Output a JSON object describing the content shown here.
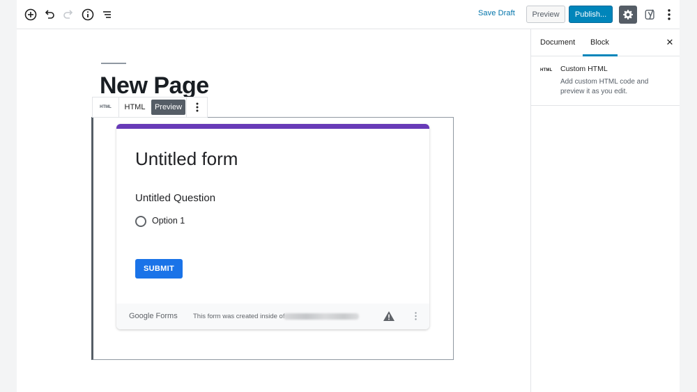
{
  "toolbar": {
    "icons": [
      "add-block-icon",
      "undo-icon",
      "redo-icon",
      "info-icon",
      "outline-icon"
    ],
    "save_draft": "Save Draft",
    "preview": "Preview",
    "publish": "Publish...",
    "settings_icon": "gear-icon",
    "plugin_icon": "yoast-icon",
    "more_icon": "more-vertical-icon"
  },
  "editor": {
    "page_title": "New Page",
    "block_toolbar": {
      "block_icon": "HTML",
      "html_tab": "HTML",
      "preview_tab": "Preview"
    }
  },
  "form": {
    "title": "Untitled form",
    "question": "Untitled Question",
    "option": "Option 1",
    "submit": "SUBMIT",
    "footer_brand": "Google Forms",
    "footer_note": "This form was created inside of",
    "accent_color": "#673ab7",
    "button_color": "#1a73e8"
  },
  "sidebar": {
    "tabs": [
      "Document",
      "Block"
    ],
    "active_tab": "Block",
    "block_icon": "HTML",
    "block_name": "Custom HTML",
    "block_description": "Add custom HTML code and preview it as you edit."
  },
  "colors": {
    "primary": "#0085ba",
    "link": "#0073aa",
    "dark": "#555d66"
  }
}
